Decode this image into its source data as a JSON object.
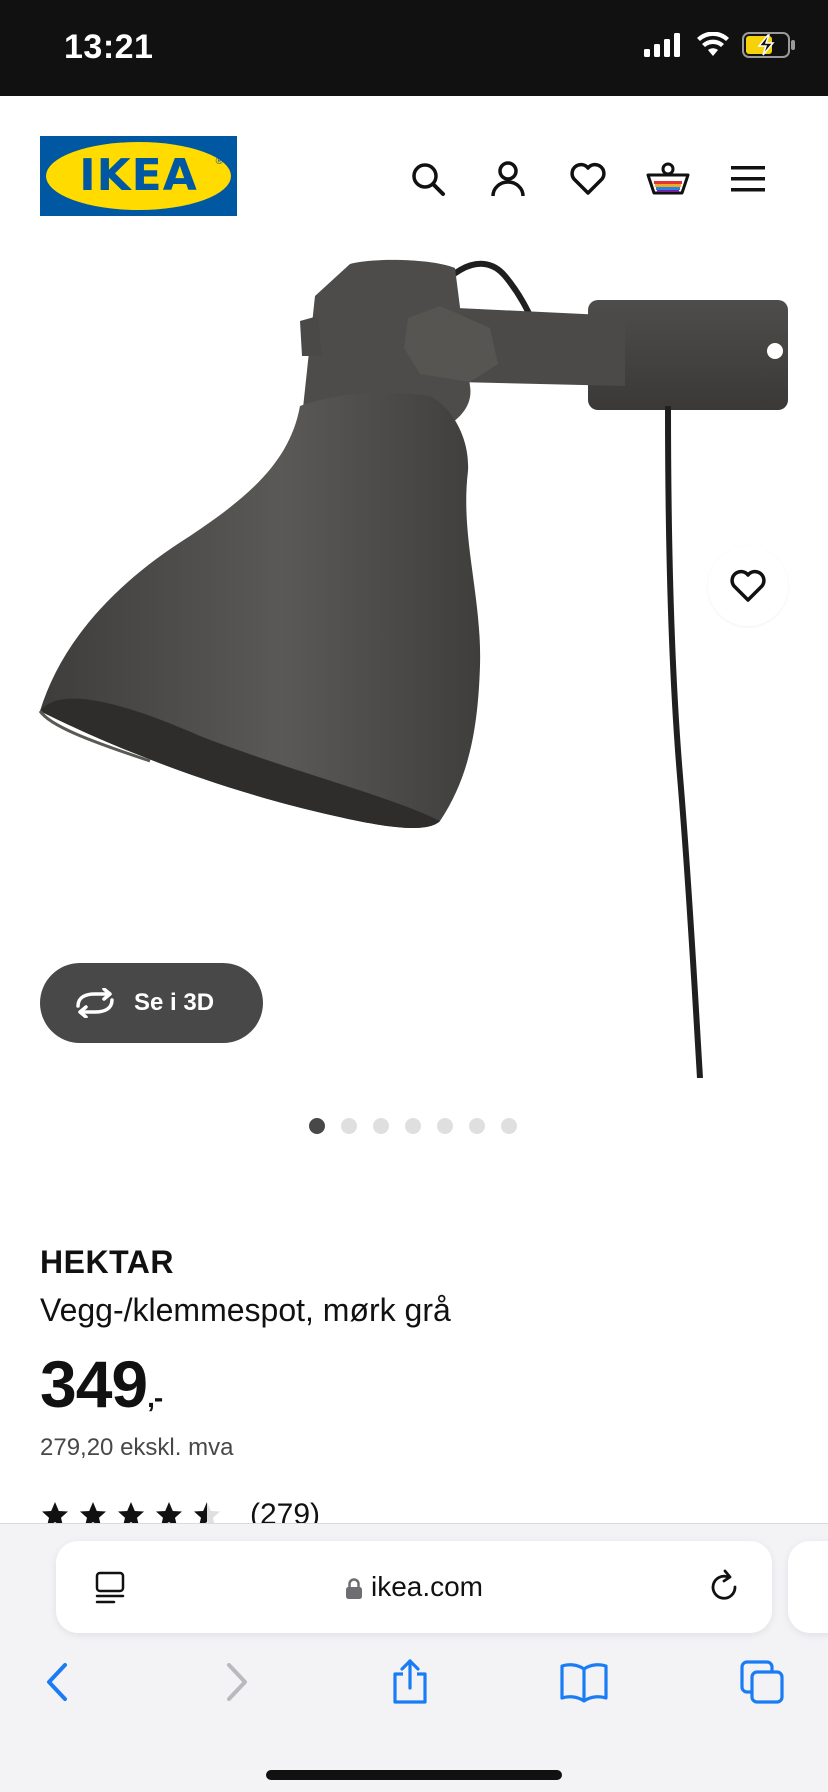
{
  "status_bar": {
    "time": "13:21"
  },
  "header": {
    "logo_text": "IKEA",
    "logo_reg": "®",
    "icons": [
      "search-icon",
      "account-icon",
      "heart-icon",
      "basket-icon",
      "menu-icon"
    ]
  },
  "gallery": {
    "see_3d_label": "Se i 3D",
    "dot_count": 7,
    "active_dot": 1
  },
  "product": {
    "brand": "HEKTAR",
    "description": "Vegg-/klemmespot, mørk grå",
    "price": "349",
    "price_suffix": ",-",
    "price_ex_vat": "279,20 ekskl. mva",
    "rating_value": 4.5,
    "rating_count": "(279)"
  },
  "safari": {
    "url": "ikea.com"
  },
  "colors": {
    "ikea_blue": "#0058a3",
    "ikea_yellow": "#ffdb00",
    "pill_dark": "#484848"
  }
}
